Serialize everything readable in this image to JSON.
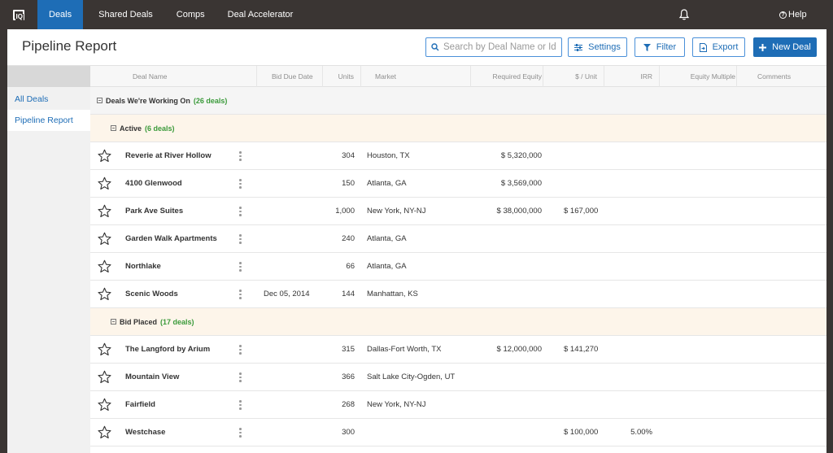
{
  "nav": {
    "logo_text": "IQ",
    "items": [
      "Deals",
      "Shared Deals",
      "Comps",
      "Deal Accelerator"
    ],
    "help_label": "Help"
  },
  "header": {
    "title": "Pipeline Report",
    "search_placeholder": "Search by Deal Name or Id",
    "settings_label": "Settings",
    "filter_label": "Filter",
    "export_label": "Export",
    "new_deal_label": "New Deal"
  },
  "sidebar": {
    "items": [
      "All Deals",
      "Pipeline Report"
    ]
  },
  "columns": [
    "Deal Name",
    "Bid Due Date",
    "Units",
    "Market",
    "Required Equity",
    "$ / Unit",
    "IRR",
    "Equity Multiple",
    "Comments"
  ],
  "group": {
    "label": "Deals We're Working On",
    "count": "(26 deals)"
  },
  "subgroups": [
    {
      "label": "Active",
      "count": "(6 deals)",
      "rows": [
        {
          "name": "Reverie at River Hollow",
          "bid_due": "",
          "units": "304",
          "market": "Houston, TX",
          "equity": "$ 5,320,000",
          "per_unit": "",
          "irr": ""
        },
        {
          "name": "4100 Glenwood",
          "bid_due": "",
          "units": "150",
          "market": "Atlanta, GA",
          "equity": "$ 3,569,000",
          "per_unit": "",
          "irr": ""
        },
        {
          "name": "Park Ave Suites",
          "bid_due": "",
          "units": "1,000",
          "market": "New York, NY-NJ",
          "equity": "$ 38,000,000",
          "per_unit": "$ 167,000",
          "irr": ""
        },
        {
          "name": "Garden Walk Apartments",
          "bid_due": "",
          "units": "240",
          "market": "Atlanta, GA",
          "equity": "",
          "per_unit": "",
          "irr": ""
        },
        {
          "name": "Northlake",
          "bid_due": "",
          "units": "66",
          "market": "Atlanta, GA",
          "equity": "",
          "per_unit": "",
          "irr": ""
        },
        {
          "name": "Scenic Woods",
          "bid_due": "Dec 05, 2014",
          "units": "144",
          "market": "Manhattan, KS",
          "equity": "",
          "per_unit": "",
          "irr": ""
        }
      ]
    },
    {
      "label": "Bid Placed",
      "count": "(17 deals)",
      "rows": [
        {
          "name": "The Langford by Arium",
          "bid_due": "",
          "units": "315",
          "market": "Dallas-Fort Worth, TX",
          "equity": "$ 12,000,000",
          "per_unit": "$ 141,270",
          "irr": ""
        },
        {
          "name": "Mountain View",
          "bid_due": "",
          "units": "366",
          "market": "Salt Lake City-Ogden, UT",
          "equity": "",
          "per_unit": "",
          "irr": ""
        },
        {
          "name": "Fairfield",
          "bid_due": "",
          "units": "268",
          "market": "New York, NY-NJ",
          "equity": "",
          "per_unit": "",
          "irr": ""
        },
        {
          "name": "Westchase",
          "bid_due": "",
          "units": "300",
          "market": "",
          "equity": "",
          "per_unit": "$ 100,000",
          "irr": "5.00%"
        }
      ]
    }
  ],
  "colors": {
    "brand_blue": "#1e6db6",
    "nav_bg": "#3a3533",
    "count_green": "#3a9a3a",
    "subgroup_bg": "#fdf5ea"
  }
}
